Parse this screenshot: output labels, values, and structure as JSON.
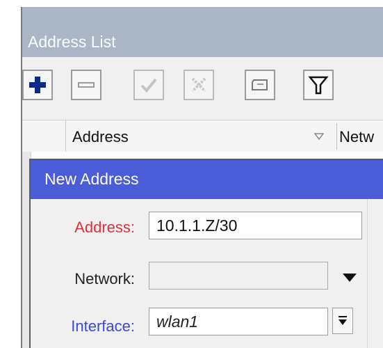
{
  "address_list": {
    "title": "Address List",
    "toolbar": {
      "add": "plus-icon",
      "remove": "minus-icon",
      "enable": "check-icon",
      "disable": "cross-icon",
      "comment": "comment-icon",
      "filter": "filter-icon"
    },
    "columns": {
      "address": "Address",
      "network": "Netw"
    }
  },
  "dialog": {
    "title": "New Address",
    "address": {
      "label": "Address:",
      "value": "10.1.1.Z/30"
    },
    "network": {
      "label": "Network:",
      "value": ""
    },
    "interface": {
      "label": "Interface:",
      "value": "wlan1"
    }
  },
  "colors": {
    "dialog_title_bg": "#4b5cd8",
    "list_title_bg": "#aab5c6",
    "required_label": "#e0303a",
    "interface_label": "#3b49d8"
  }
}
